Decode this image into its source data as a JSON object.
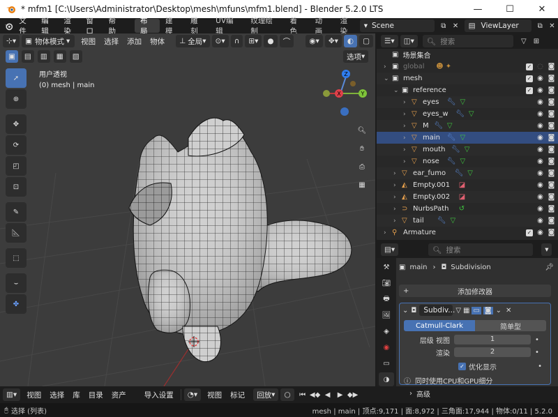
{
  "window": {
    "title": "* mfm1 [C:\\Users\\Administrator\\Desktop\\mesh\\mfuns\\mfm1.blend] - Blender 5.2.0 LTS"
  },
  "menu": [
    "文件",
    "编辑",
    "渲染",
    "窗口",
    "帮助"
  ],
  "workspaces": [
    "布局",
    "建模",
    "雕刻",
    "UV编辑",
    "纹理绘制",
    "着色",
    "动画",
    "渲染"
  ],
  "active_workspace": "布局",
  "scene": {
    "label": "Scene"
  },
  "view_layer": {
    "label": "ViewLayer"
  },
  "viewport": {
    "mode": "物体模式",
    "menus": [
      "视图",
      "选择",
      "添加",
      "物体"
    ],
    "transform_orientation": "全局",
    "options_label": "选项",
    "view_name": "用户透视",
    "object_info": "(0) mesh | main",
    "gizmo": {
      "x": "X",
      "y": "Y",
      "z": "Z"
    }
  },
  "outliner": {
    "search_placeholder": "搜索",
    "root": "场景集合",
    "rows": [
      {
        "name": "global",
        "muted": true
      },
      {
        "name": "mesh"
      },
      {
        "name": "reference"
      },
      {
        "name": "eyes"
      },
      {
        "name": "eyes_w"
      },
      {
        "name": "M"
      },
      {
        "name": "main",
        "selected": true
      },
      {
        "name": "mouth"
      },
      {
        "name": "nose"
      },
      {
        "name": "ear_fumo"
      },
      {
        "name": "Empty.001"
      },
      {
        "name": "Empty.002"
      },
      {
        "name": "NurbsPath"
      },
      {
        "name": "tail"
      },
      {
        "name": "Armature"
      }
    ]
  },
  "properties": {
    "search_placeholder": "搜索",
    "breadcrumb_object": "main",
    "breadcrumb_modifier": "Subdivision",
    "add_modifier": "添加修改器",
    "modifier_name": "Subdiv...",
    "type_options": [
      "Catmull-Clark",
      "简单型"
    ],
    "levels_label": "层级 视图",
    "levels_value": "1",
    "render_label": "渲染",
    "render_value": "2",
    "optimal_display": "优化显示",
    "gpu_label": "同时使用CPU和GPU细分",
    "advanced": "高级"
  },
  "timeline": {
    "menus": [
      "视图",
      "选择",
      "库",
      "目录",
      "资产"
    ],
    "import_settings": "导入设置",
    "menus2": [
      "视图",
      "标记"
    ],
    "playback": "回放"
  },
  "status": {
    "left": "选择 (列表)",
    "right": "mesh | main | 顶点:9,171 | 面:8,972 | 三角面:17,944 | 物体:0/11 | 5.2.0"
  },
  "colors": {
    "accent": "#4772b3",
    "selection": "#334d80",
    "mesh_icon": "#e8a14d",
    "modifier_icon": "#5a8ad8",
    "vertex_group": "#3fc43f"
  }
}
